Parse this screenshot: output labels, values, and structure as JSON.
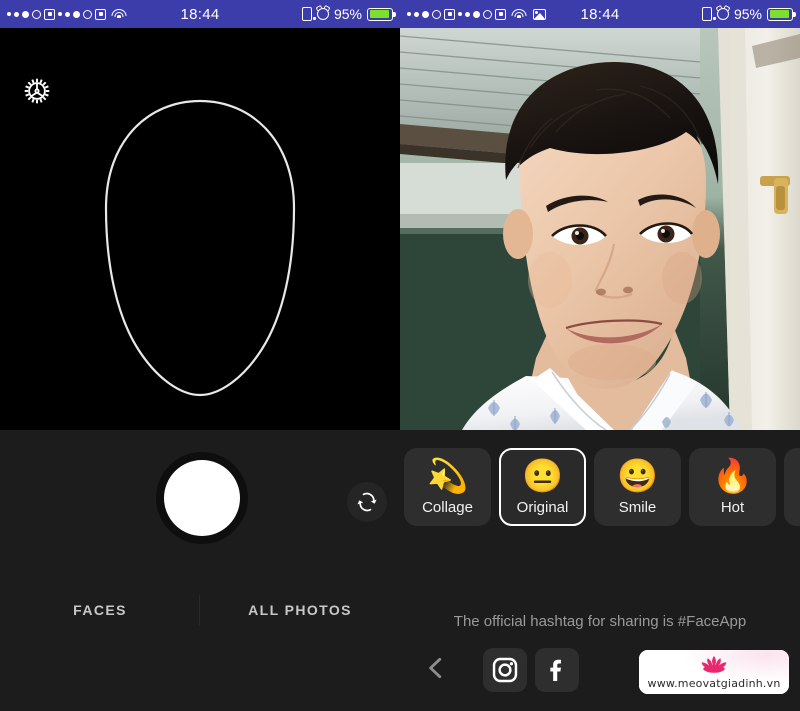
{
  "status_bar": {
    "time": "18:44",
    "battery_percent": "95%",
    "battery_level": 95,
    "battery_color": "#7ee02e",
    "bar_color": "#3c3caa",
    "left_icons": [
      "signal-dots",
      "carrier-badge",
      "signal-dots",
      "carrier-badge",
      "wifi-icon"
    ],
    "right_icons": [
      "rotation-lock-icon",
      "alarm-clock-icon",
      "battery-icon"
    ],
    "second_bar_extra_icon": "photo-icon"
  },
  "camera_pane": {
    "settings_icon": "gear-icon",
    "face_guide": "face-oval-outline",
    "background": "#000000"
  },
  "photo_pane": {
    "description": "Selfie portrait of a young man in a white patterned shirt in front of a corrugated metal roof and dark green wall"
  },
  "capture": {
    "shutter_label": "shutter-button",
    "flip_label": "flip-camera-button"
  },
  "filters": {
    "items": [
      {
        "label": "Collage",
        "emoji": "💫",
        "icon": "sparkle-star-icon",
        "selected": false
      },
      {
        "label": "Original",
        "emoji": "😐",
        "icon": "neutral-face-icon",
        "selected": true
      },
      {
        "label": "Smile",
        "emoji": "😀",
        "icon": "grinning-face-icon",
        "selected": false
      },
      {
        "label": "Hot",
        "emoji": "🔥",
        "icon": "fire-icon",
        "selected": false
      }
    ]
  },
  "tabs": {
    "items": [
      {
        "label": "FACES"
      },
      {
        "label": "ALL PHOTOS"
      }
    ]
  },
  "hashtag_note": "The official hashtag for sharing is #FaceApp",
  "bottom_bar": {
    "back_icon": "chevron-left-icon",
    "social": [
      {
        "name": "instagram-icon"
      },
      {
        "name": "facebook-icon"
      }
    ],
    "watermark": {
      "url": "www.meovatgiadinh.vn",
      "logo": "lotus-flower-icon",
      "logo_color": "#e8286f"
    }
  }
}
